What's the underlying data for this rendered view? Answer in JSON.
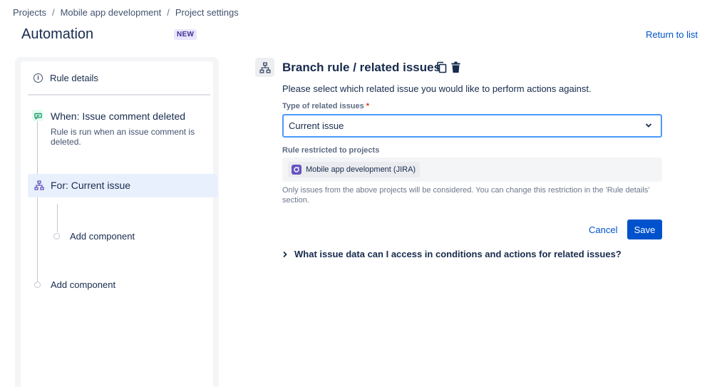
{
  "breadcrumb": {
    "items": [
      "Projects",
      "Mobile app development",
      "Project settings"
    ],
    "separator": "/"
  },
  "header": {
    "title": "Automation",
    "badge": "NEW",
    "return_link": "Return to list"
  },
  "rule_panel": {
    "rule_details_label": "Rule details",
    "trigger": {
      "title": "When: Issue comment deleted",
      "description": "Rule is run when an issue comment is deleted."
    },
    "branch": {
      "title": "For: Current issue"
    },
    "add_component_nested": "Add component",
    "add_component_root": "Add component"
  },
  "editor": {
    "title": "Branch rule / related issues",
    "instruction": "Please select which related issue you would like to perform actions against.",
    "type_label": "Type of related issues",
    "required_mark": "*",
    "type_value": "Current issue",
    "restricted_label": "Rule restricted to projects",
    "project_tag": "Mobile app development (JIRA)",
    "help_text": "Only issues from the above projects will be considered. You can change this restriction in the 'Rule details' section.",
    "cancel_label": "Cancel",
    "save_label": "Save",
    "expander_label": "What issue data can I access in conditions and actions for related issues?"
  },
  "colors": {
    "primary": "#0052cc",
    "focus_border": "#4c9aff",
    "selected_bg": "#e9f0fd",
    "trigger_icon_bg": "#e3fcef",
    "branch_icon": "#6554c0",
    "required": "#de350b"
  },
  "icons": [
    "info-icon",
    "chat-icon",
    "branch-icon",
    "copy-icon",
    "trash-icon",
    "chevron-down-icon",
    "chevron-right-icon",
    "project-icon"
  ]
}
